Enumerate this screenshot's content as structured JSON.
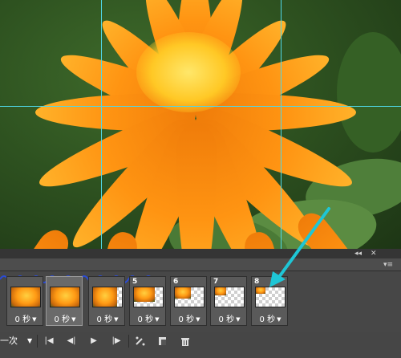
{
  "panel": {
    "collapse_glyph": "◂◂",
    "close_glyph": "✕",
    "menu_glyph": "▾≡"
  },
  "frames": [
    {
      "number": "",
      "delay": "0 秒",
      "selected": false
    },
    {
      "number": "",
      "delay": "0 秒",
      "selected": true
    },
    {
      "number": "",
      "delay": "0 秒",
      "selected": false
    },
    {
      "number": "5",
      "delay": "0 秒",
      "selected": false
    },
    {
      "number": "6",
      "delay": "0 秒",
      "selected": false
    },
    {
      "number": "7",
      "delay": "0 秒",
      "selected": false
    },
    {
      "number": "8",
      "delay": "0 秒",
      "selected": false
    }
  ],
  "controls": {
    "loop_label": "一次",
    "loop_arrow": "▼",
    "first_frame_glyph": "|◀",
    "prev_frame_glyph": "◀|",
    "play_glyph": "▶",
    "next_frame_glyph": "|▶"
  },
  "annotation": {
    "arrow_color": "#1ec6d6"
  }
}
